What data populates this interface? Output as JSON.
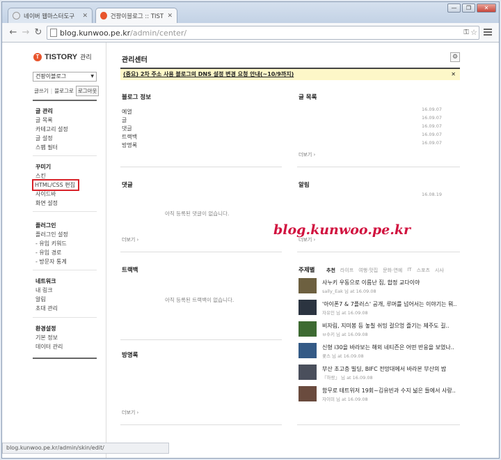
{
  "browser": {
    "tabs": [
      {
        "label": "네이버 웹마스터도구",
        "favicon_color": "#e5e9ef"
      },
      {
        "label": "건팡이블로그 :: TISTORY",
        "favicon_color": "#e8542c"
      }
    ],
    "url_host": "blog.kunwoo.pe.kr",
    "url_path": "/admin/center/",
    "status_url": "blog.kunwoo.pe.kr/admin/skin/edit/"
  },
  "sidebar": {
    "logo": "TISTORY",
    "logo_admin": "관리",
    "blog_select": "건팡이블로그",
    "quick": {
      "write": "글쓰기",
      "blog": "블로그로",
      "logout": "로그아웃"
    },
    "groups": [
      {
        "head": "글 관리",
        "items": [
          "글 목록",
          "카테고리 설정",
          "글 설정",
          "스팸 필터"
        ]
      },
      {
        "head": "꾸미기",
        "items": [
          "스킨",
          "HTML/CSS 편집",
          "사이드바",
          "화면 설정"
        ]
      },
      {
        "head": "플러그인",
        "items": [
          "플러그인 설정",
          "- 유입 키워드",
          "- 유입 경로",
          "- 방문자 통계"
        ]
      },
      {
        "head": "네트워크",
        "items": [
          "내 링크",
          "알림",
          "초대 관리"
        ]
      },
      {
        "head": "환경설정",
        "items": [
          "기본 정보",
          "데이터 관리"
        ]
      }
    ]
  },
  "main": {
    "title": "관리센터",
    "notice": "(중요) 2차 주소 사용 블로그의 DNS 설정 변경 요청 안내(~10/9까지)",
    "blog_info": {
      "title": "블로그 정보",
      "items": [
        "예열",
        "글",
        "댓글",
        "트랙백",
        "방명록"
      ]
    },
    "post_list": {
      "title": "글 목록",
      "dates": [
        "16.09.07",
        "16.09.07",
        "16.09.07",
        "16.09.07",
        "16.09.07"
      ],
      "more": "더보기 ›"
    },
    "comments": {
      "title": "댓글",
      "empty": "아직 등록된 댓글이 없습니다.",
      "more": "더보기 ›"
    },
    "notifications": {
      "title": "알림",
      "date": "16.08.19",
      "more": "더보기 ›"
    },
    "trackback": {
      "title": "트랙백",
      "empty": "아직 등록된 트랙백이 없습니다."
    },
    "guestbook": {
      "title": "방명록",
      "more": "더보기 ›"
    },
    "topics": {
      "title": "주제별",
      "tabs": [
        "추천",
        "라이프",
        "여행·맛집",
        "문화·연예",
        "IT",
        "스포츠",
        "시사"
      ],
      "items": [
        {
          "title": "사누키 우동으로 이름난 집, 합정 교다이야",
          "meta": "sally_Eak 님 at 16.09.08",
          "thumb": "#6d6040"
        },
        {
          "title": "'아이폰7 & 7플러스' 공개, 루머를 넘어서는 이야기는 뭐..",
          "meta": "자유인 님 at 16.09.08",
          "thumb": "#2b3440"
        },
        {
          "title": "비자림, 지미봉 등 놓칠 쉬밍 걸으엉 즐기는 제주도 길..",
          "meta": "ㅂ수키 님 at 16.09.08",
          "thumb": "#3d6a32"
        },
        {
          "title": "신형 i30을 바라보는 해외 네티즌은 어떤 반응을 보였나..",
          "meta": "꽃스 님 at 16.09.08",
          "thumb": "#345a86"
        },
        {
          "title": "부산 초고층 빌딩, BIFC 전망대에서 바라본 부산의 밤",
          "meta": "『하랑』 님 at 16.09.08",
          "thumb": "#4a4f5c"
        },
        {
          "title": "함무로 테트위저 19회~김유빈과 수지 넒은 들에서 사랑..",
          "meta": "자이미 님 at 16.09.08",
          "thumb": "#6a4b3e"
        }
      ]
    }
  },
  "watermark": "blog.kunwoo.pe.kr"
}
